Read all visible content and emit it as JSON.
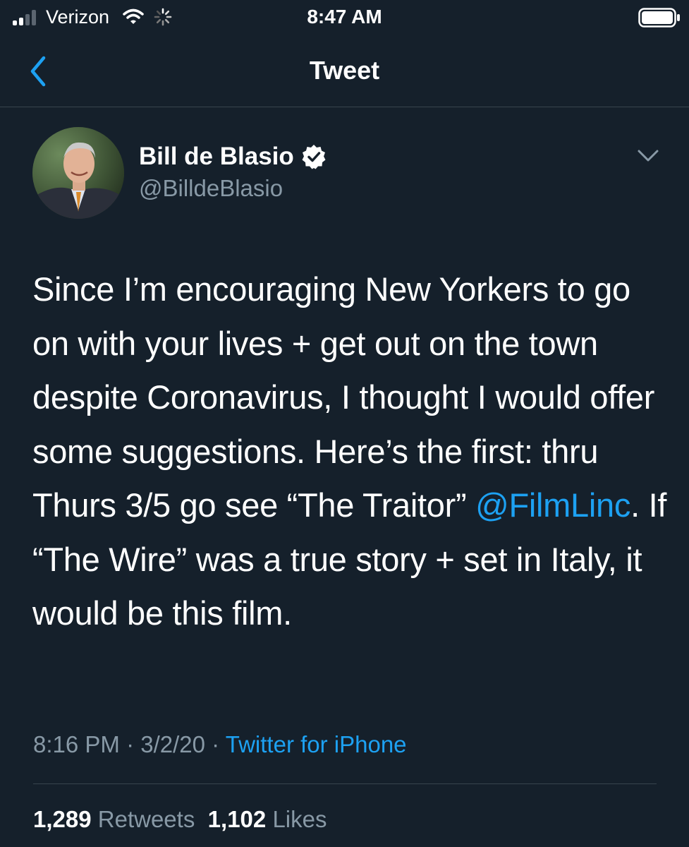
{
  "status_bar": {
    "carrier": "Verizon",
    "time": "8:47 AM",
    "icons": [
      "signal-icon",
      "wifi-icon",
      "activity-icon",
      "battery-icon"
    ]
  },
  "nav": {
    "title": "Tweet",
    "back_icon": "chevron-left-icon"
  },
  "tweet": {
    "author": {
      "name": "Bill de Blasio",
      "handle": "@BilldeBlasio",
      "verified": true
    },
    "text_before_mention": "Since I’m encouraging New Yorkers to go on with your lives + get out on the town despite Coronavirus, I thought I would offer some suggestions. Here’s the first: thru Thurs 3/5 go see “The Traitor” ",
    "mention": "@FilmLinc",
    "text_after_mention": ". If “The Wire” was a true story + set in Italy, it would be this film.",
    "time": "8:16 PM",
    "separator": "·",
    "date": "3/2/20",
    "source": "Twitter for iPhone",
    "retweets_count": "1,289",
    "retweets_label": "Retweets",
    "likes_count": "1,102",
    "likes_label": "Likes"
  },
  "colors": {
    "background": "#15202b",
    "accent": "#1da1f2",
    "secondary_text": "#8899a6",
    "divider": "#38444d"
  }
}
